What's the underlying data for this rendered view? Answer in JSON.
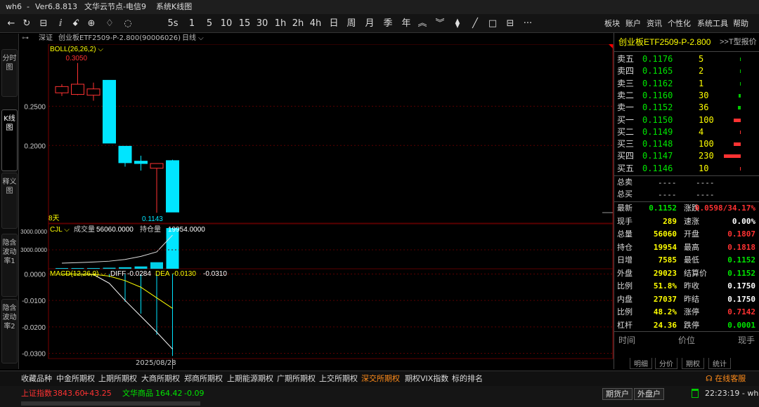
{
  "window": {
    "app": "wh6",
    "separator": "-",
    "version": "Ver6.8.813",
    "node": "文华云节点-电信9",
    "mode": "系统K线图"
  },
  "toolbar": {
    "icons": [
      {
        "name": "back-icon",
        "glyph": "←"
      },
      {
        "name": "refresh-icon",
        "glyph": "↻"
      },
      {
        "name": "table-icon",
        "glyph": "⊟"
      },
      {
        "name": "candle-icon",
        "glyph": "ⅈ"
      },
      {
        "name": "kline-icon",
        "glyph": "ꗃ"
      },
      {
        "name": "indicator-icon",
        "glyph": "⊕"
      },
      {
        "name": "alarm-icon",
        "glyph": "♢"
      },
      {
        "name": "timer-icon",
        "glyph": "◌"
      }
    ],
    "periods": [
      "5s",
      "1",
      "5",
      "10",
      "15",
      "30",
      "1h",
      "2h",
      "4h",
      "日",
      "周",
      "月",
      "季",
      "年"
    ],
    "tools": [
      {
        "name": "zoom-in-icon",
        "glyph": "︽"
      },
      {
        "name": "zoom-out-icon",
        "glyph": "︾"
      },
      {
        "name": "crosshair-icon",
        "glyph": "⧫"
      },
      {
        "name": "line-draw-icon",
        "glyph": "╱"
      },
      {
        "name": "rect-icon",
        "glyph": "□"
      },
      {
        "name": "draw-tools-icon",
        "glyph": "⊟"
      },
      {
        "name": "more-icon",
        "glyph": "···"
      }
    ],
    "menus": [
      "板块",
      "账户",
      "资讯",
      "个性化",
      "系统工具",
      "帮助"
    ]
  },
  "left_tabs": [
    "分时图",
    "K线图",
    "释义图",
    "隐含波动率1",
    "隐含波动率2"
  ],
  "chart_header": {
    "exchange": "深证",
    "contract": "创业板ETF2509-P-2.800(90006026)",
    "period": "日线"
  },
  "main_panel": {
    "indicator": "BOLL(26,26,2)",
    "high_label": "0.3050",
    "low_label": "0.1143",
    "days_label": "8天"
  },
  "volume_panel": {
    "indicator": "CJL",
    "volume_label": "成交量",
    "volume_value": "56060.0000",
    "oi_label": "持仓量",
    "oi_value": "19954.0000"
  },
  "macd_panel": {
    "indicator": "MACD(12,26,9)",
    "diff_label": "DIFF",
    "diff_value": "-0.0284",
    "dea_label": "DEA",
    "dea_value": "-0.0130",
    "macd_value": "-0.0310"
  },
  "date_label": "2025/08/28",
  "right_panel": {
    "title": "创业板ETF2509-P-2.800",
    "quote_mode": ">>T型报价",
    "asks": [
      {
        "label": "卖五",
        "price": "0.1176",
        "qty": "5",
        "bar": 0.02
      },
      {
        "label": "卖四",
        "price": "0.1165",
        "qty": "2",
        "bar": 0.01
      },
      {
        "label": "卖三",
        "price": "0.1162",
        "qty": "1",
        "bar": 0.005
      },
      {
        "label": "卖二",
        "price": "0.1160",
        "qty": "30",
        "bar": 0.13
      },
      {
        "label": "卖一",
        "price": "0.1152",
        "qty": "36",
        "bar": 0.16
      }
    ],
    "bids": [
      {
        "label": "买一",
        "price": "0.1150",
        "qty": "100",
        "bar": 0.43
      },
      {
        "label": "买二",
        "price": "0.1149",
        "qty": "4",
        "bar": 0.02
      },
      {
        "label": "买三",
        "price": "0.1148",
        "qty": "100",
        "bar": 0.43
      },
      {
        "label": "买四",
        "price": "0.1147",
        "qty": "230",
        "bar": 1.0
      },
      {
        "label": "买五",
        "price": "0.1146",
        "qty": "10",
        "bar": 0.04
      }
    ],
    "totals": [
      {
        "label": "总卖",
        "a": "----",
        "b": "----"
      },
      {
        "label": "总买",
        "a": "----",
        "b": "----"
      }
    ],
    "stats": [
      {
        "l1": "最新",
        "v1": "0.1152",
        "c1": "green",
        "l2": "涨跌",
        "v2": "0.0598/34.17%",
        "c2": "red"
      },
      {
        "l1": "现手",
        "v1": "289",
        "c1": "yellow",
        "l2": "速涨",
        "v2": "0.00%",
        "c2": "white"
      },
      {
        "l1": "总量",
        "v1": "56060",
        "c1": "yellow",
        "l2": "开盘",
        "v2": "0.1807",
        "c2": "red"
      },
      {
        "l1": "持仓",
        "v1": "19954",
        "c1": "yellow",
        "l2": "最高",
        "v2": "0.1818",
        "c2": "red"
      },
      {
        "l1": "日增",
        "v1": "7585",
        "c1": "yellow",
        "l2": "最低",
        "v2": "0.1152",
        "c2": "green"
      },
      {
        "l1": "外盘",
        "v1": "29023",
        "c1": "yellow",
        "l2": "结算价",
        "v2": "0.1152",
        "c2": "green"
      },
      {
        "l1": "比例",
        "v1": "51.8%",
        "c1": "yellow",
        "l2": "昨收",
        "v2": "0.1750",
        "c2": "white"
      },
      {
        "l1": "内盘",
        "v1": "27037",
        "c1": "yellow",
        "l2": "昨结",
        "v2": "0.1750",
        "c2": "white"
      },
      {
        "l1": "比例",
        "v1": "48.2%",
        "c1": "yellow",
        "l2": "涨停",
        "v2": "0.7142",
        "c2": "red"
      },
      {
        "l1": "杠杆",
        "v1": "24.36",
        "c1": "yellow",
        "l2": "跌停",
        "v2": "0.0001",
        "c2": "green"
      }
    ],
    "trade_headers": [
      "时间",
      "价位",
      "现手"
    ],
    "bottom_tabs": [
      "明细",
      "分价",
      "期权",
      "统计"
    ]
  },
  "exchange_tabs": [
    "收藏品种",
    "中金所期权",
    "上期所期权",
    "大商所期权",
    "郑商所期权",
    "上期能源期权",
    "广期所期权",
    "上交所期权",
    "深交所期权",
    "期权VIX指数",
    "标的排名"
  ],
  "active_exchange_tab": "深交所期权",
  "status": {
    "sh_label": "上证指数",
    "sh_value": "3843.60",
    "sh_change": "+43.25",
    "wh_label": "文华商品",
    "wh_value": "164.42",
    "wh_change": "-0.09",
    "btn_futures": "期货户",
    "btn_external": "外盘户",
    "time": "22:23:19 - wh",
    "service": "在线客服"
  },
  "colors": {
    "up": "#ff3232",
    "down": "#00e5ff",
    "grid": "#5a0000",
    "boll_upper": "#ffffff",
    "boll_mid": "#ffff00",
    "diff": "#ffffff",
    "dea": "#ffff00",
    "active_tab": "#ff8c1a"
  },
  "chart_data": {
    "type": "candlestick",
    "price_axis": {
      "ticks": [
        "0.2500",
        "0.2000"
      ],
      "range": [
        0.11,
        0.32
      ]
    },
    "macd_axis": {
      "ticks": [
        "0.0000",
        "-0.0100",
        "-0.0200",
        "-0.0300"
      ],
      "range": [
        -0.032,
        0.002
      ]
    },
    "volume_axis": {
      "ticks": [
        "3000.0000",
        "3000.0000"
      ]
    },
    "candles": [
      {
        "open": 0.267,
        "close": 0.275,
        "high": 0.278,
        "low": 0.263
      },
      {
        "open": 0.265,
        "close": 0.278,
        "high": 0.305,
        "low": 0.264
      },
      {
        "open": 0.264,
        "close": 0.272,
        "high": 0.28,
        "low": 0.257
      },
      {
        "open": 0.283,
        "close": 0.203,
        "high": 0.283,
        "low": 0.203
      },
      {
        "open": 0.199,
        "close": 0.178,
        "high": 0.199,
        "low": 0.173
      },
      {
        "open": 0.18,
        "close": 0.177,
        "high": 0.187,
        "low": 0.168
      },
      {
        "open": 0.171,
        "close": 0.177,
        "high": 0.177,
        "low": 0.1143
      },
      {
        "open": 0.1807,
        "close": 0.1152,
        "high": 0.1818,
        "low": 0.1152
      }
    ],
    "volumes": [
      200,
      500,
      900,
      1400,
      2100,
      3200,
      9000,
      56060
    ],
    "oi": [
      10000,
      10200,
      10400,
      10700,
      11300,
      12400,
      14000,
      19954
    ],
    "macd": [
      -0.0002,
      -0.0004,
      -0.0006,
      -0.0012,
      -0.0105,
      -0.015,
      -0.023,
      -0.031
    ],
    "diff": [
      0.0,
      0.0,
      -0.0002,
      -0.0035,
      -0.01,
      -0.016,
      -0.022,
      -0.0284
    ],
    "dea": [
      0.0,
      0.0,
      -0.0001,
      -0.0008,
      -0.0025,
      -0.005,
      -0.009,
      -0.013
    ]
  }
}
